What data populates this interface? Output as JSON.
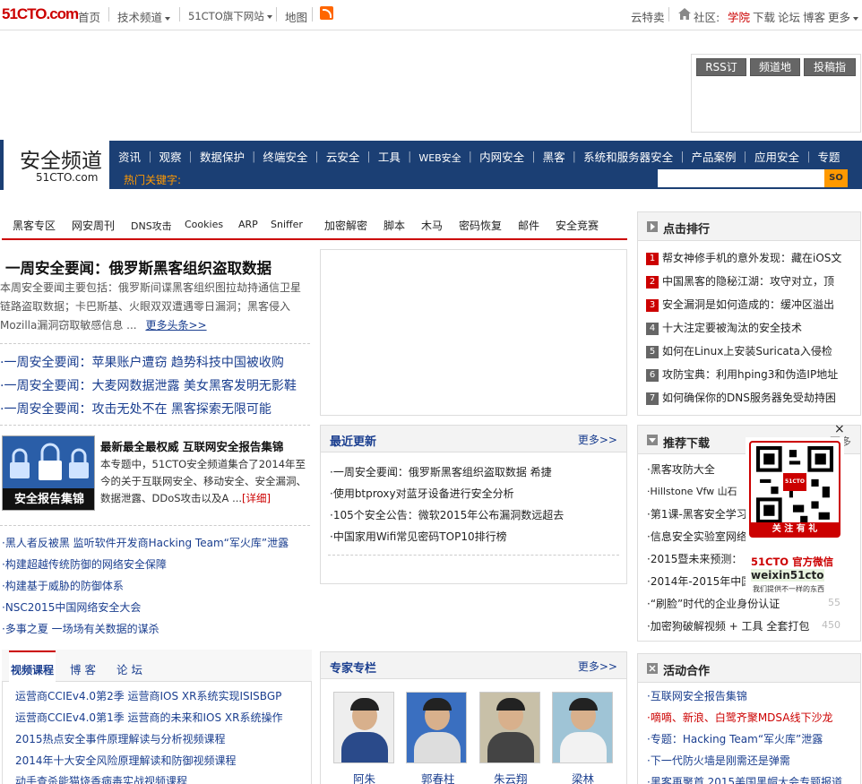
{
  "topbar": {
    "logo": "51CTO.com",
    "nav": [
      "首页",
      "技术频道",
      "51CTO旗下网站",
      "地图"
    ],
    "right_links": [
      "云特卖",
      "社区:",
      "学院",
      "下载",
      "论坛",
      "博客",
      "更多"
    ]
  },
  "guide_buttons": [
    "RSS订阅",
    "频道地图",
    "投稿指南"
  ],
  "channel": {
    "title": "安全频道",
    "site": "51CTO.com",
    "nav": [
      "资讯",
      "观察",
      "数据保护",
      "终端安全",
      "云安全",
      "工具",
      "WEB安全",
      "内网安全",
      "黑客",
      "系统和服务器安全",
      "产品案例",
      "应用安全",
      "专题"
    ],
    "hot_keywords_label": "热门关键字:",
    "search_button": "SO"
  },
  "category_bar": [
    "黑客专区",
    "网安周刊",
    "DNS攻击",
    "Cookies",
    "ARP",
    "Sniffer",
    "加密解密",
    "脚本",
    "木马",
    "密码恢复",
    "邮件",
    "安全竞赛"
  ],
  "headline": {
    "title": "一周安全要闻：俄罗斯黑客组织盗取数据",
    "summary": "本周安全要闻主要包括：俄罗斯间谍黑客组织图拉劫持通信卫星链路盗取数据；卡巴斯基、火眼双双遭遇零日漏洞；黑客侵入Mozilla漏洞窃取敏感信息 ...",
    "more": "更多头条>>"
  },
  "news_links": [
    "·一周安全要闻：苹果账户遭窃 趋势科技中国被收购",
    "·一周安全要闻：大麦网数据泄露 美女黑客发明无影鞋",
    "·一周安全要闻：攻击无处不在 黑客探索无限可能"
  ],
  "feature": {
    "image_caption": "安全报告集锦",
    "title": "最新最全最权威 互联网安全报告集锦",
    "desc": "本专题中，51CTO安全频道集合了2014年至今的关于互联网安全、移动安全、安全漏洞、数据泄露、DDoS攻击以及A ...",
    "detail": "[详细]"
  },
  "small_links": [
    "·黑人者反被黑 监听软件开发商Hacking Team“军火库”泄露",
    "·构建超越传统防御的网络安全保障",
    "·构建基于威胁的防御体系",
    "·NSC2015中国网络安全大会",
    "·多事之夏 一场场有关数据的谋杀"
  ],
  "video_tabs": [
    "视频课程",
    "博 客",
    "论 坛"
  ],
  "video_links": [
    "运营商CCIEv4.0第2季 运营商IOS XR系统实现ISISBGP",
    "运营商CCIEv4.0第1季 运营商的未来和IOS XR系统操作",
    "2015热点安全事件原理解读与分析视频课程",
    "2014年十大安全风险原理解读和防御视频课程",
    "动手查杀能猫烧香病毒实战视频课程"
  ],
  "recent": {
    "title": "最近更新",
    "more": "更多>>",
    "items": [
      "·一周安全要闻：俄罗斯黑客组织盗取数据 希捷",
      "·使用btproxy对蓝牙设备进行安全分析",
      "·105个安全公告：微软2015年公布漏洞数远超去",
      "·中国家用Wifi常见密码TOP10排行榜"
    ]
  },
  "experts": {
    "title": "专家专栏",
    "more": "更多>>",
    "names": [
      "阿朱",
      "郭春柱",
      "朱云翔",
      "梁林"
    ]
  },
  "ranking": {
    "title": "点击排行",
    "items": [
      "帮女神修手机的意外发现：藏在iOS文",
      "中国黑客的隐秘江湖：攻守对立，顶",
      "安全漏洞是如何造成的：缓冲区溢出",
      "十大注定要被淘汰的安全技术",
      "如何在Linux上安装Suricata入侵检",
      "攻防宝典：利用hping3和伪造IP地址",
      "如何确保你的DNS服务器免受劫持困"
    ]
  },
  "recommend": {
    "title": "推荐下载",
    "more": "更多",
    "items": [
      "·黑客攻防大全",
      "·Hillstone Vfw 山石",
      "·第1课-黑客安全学习",
      "·信息安全实验室网络",
      "·2015暨未来预测：",
      "·2014年-2015年中国",
      "·“刷脸”时代的企业身份认证",
      "·加密狗破解视频 + 工具 全套打包"
    ],
    "counts": [
      "",
      "",
      "",
      "",
      "",
      "",
      "55",
      "450"
    ]
  },
  "activities": {
    "title": "活动合作",
    "items": [
      "·互联网安全报告集锦",
      "·嘀嘀、新浪、白鹭齐聚MDSA线下沙龙",
      "·专题：Hacking Team“军火库”泄露",
      "·下一代防火墙是刚需还是弹需",
      "·黑客再聚首 2015美国黑帽大会专题报道"
    ]
  },
  "qr_popup": {
    "badge": "51CTO",
    "follow": "关 注 有 礼",
    "wechat_title": "51CTO 官方微信",
    "wechat_id": "weixin51cto",
    "slogan": "我们提供不一样的东西",
    "close": "×"
  },
  "colors": {
    "brand_red": "#cc0000",
    "nav_blue": "#1b3f74",
    "link_blue": "#1a3e8f",
    "keyword_orange": "#ff9900"
  }
}
